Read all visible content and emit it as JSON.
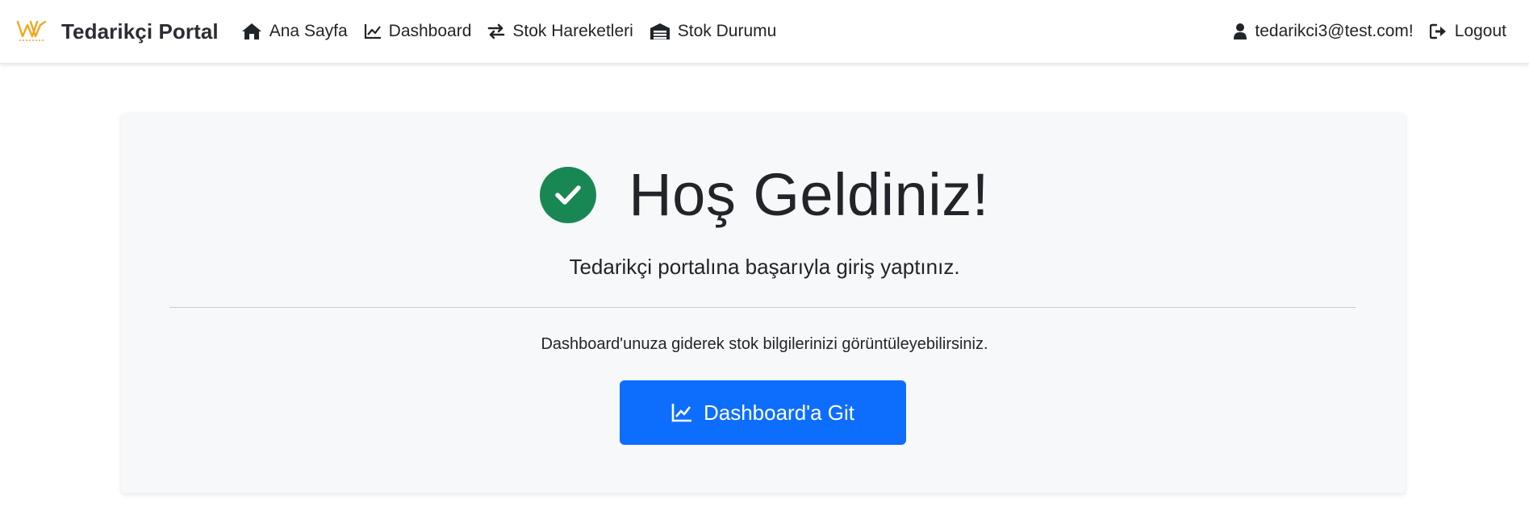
{
  "navbar": {
    "brand_name": "Tedarikçi Portal",
    "logo_icon": "brand-logo-icon",
    "links": [
      {
        "label": "Ana Sayfa",
        "icon": "home-icon"
      },
      {
        "label": "Dashboard",
        "icon": "chart-line-icon"
      },
      {
        "label": "Stok Hareketleri",
        "icon": "exchange-arrows-icon"
      },
      {
        "label": "Stok Durumu",
        "icon": "warehouse-icon"
      }
    ],
    "user_email": "tedarikci3@test.com!",
    "logout_label": "Logout"
  },
  "welcome": {
    "title": "Hoş Geldiniz!",
    "subtitle": "Tedarikçi portalına başarıyla giriş yaptınız.",
    "info": "Dashboard'unuza giderek stok bilgilerinizi görüntüleyebilirsiniz.",
    "button_label": "Dashboard'a Git"
  },
  "colors": {
    "primary": "#0d6efd",
    "success": "#198754",
    "brand_logo": "#f0a81e",
    "card_bg": "#f7f8fa"
  }
}
